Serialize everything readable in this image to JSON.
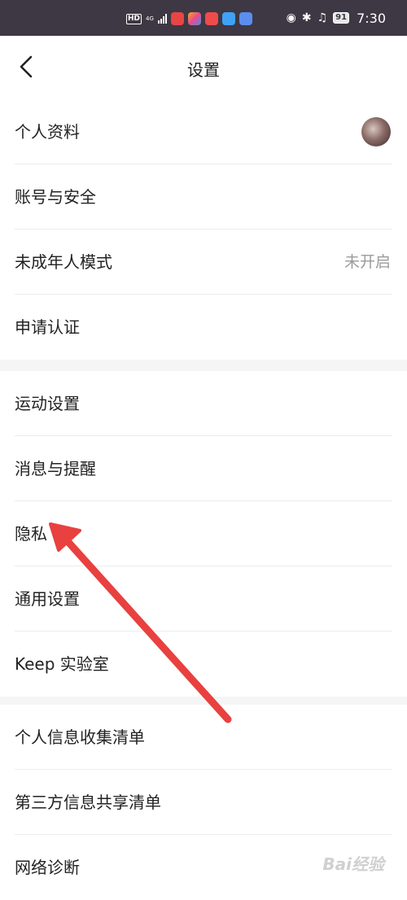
{
  "status_bar": {
    "hd_label": "HD",
    "network_label": "4G",
    "battery_level": "91",
    "time": "7:30"
  },
  "header": {
    "title": "设置"
  },
  "groups": [
    {
      "items": [
        {
          "label": "个人资料",
          "trailing": "avatar"
        },
        {
          "label": "账号与安全"
        },
        {
          "label": "未成年人模式",
          "value": "未开启"
        },
        {
          "label": "申请认证"
        }
      ]
    },
    {
      "items": [
        {
          "label": "运动设置"
        },
        {
          "label": "消息与提醒"
        },
        {
          "label": "隐私"
        },
        {
          "label": "通用设置"
        },
        {
          "label": "Keep 实验室"
        }
      ]
    },
    {
      "items": [
        {
          "label": "个人信息收集清单"
        },
        {
          "label": "第三方信息共享清单"
        },
        {
          "label": "网络诊断"
        }
      ]
    }
  ],
  "colors": {
    "status_bar_bg": "#3d3843",
    "annotation_arrow": "#e8413f",
    "section_gap": "#f5f5f5",
    "secondary_text": "#9b9b9b"
  },
  "watermark": "Bai经验"
}
